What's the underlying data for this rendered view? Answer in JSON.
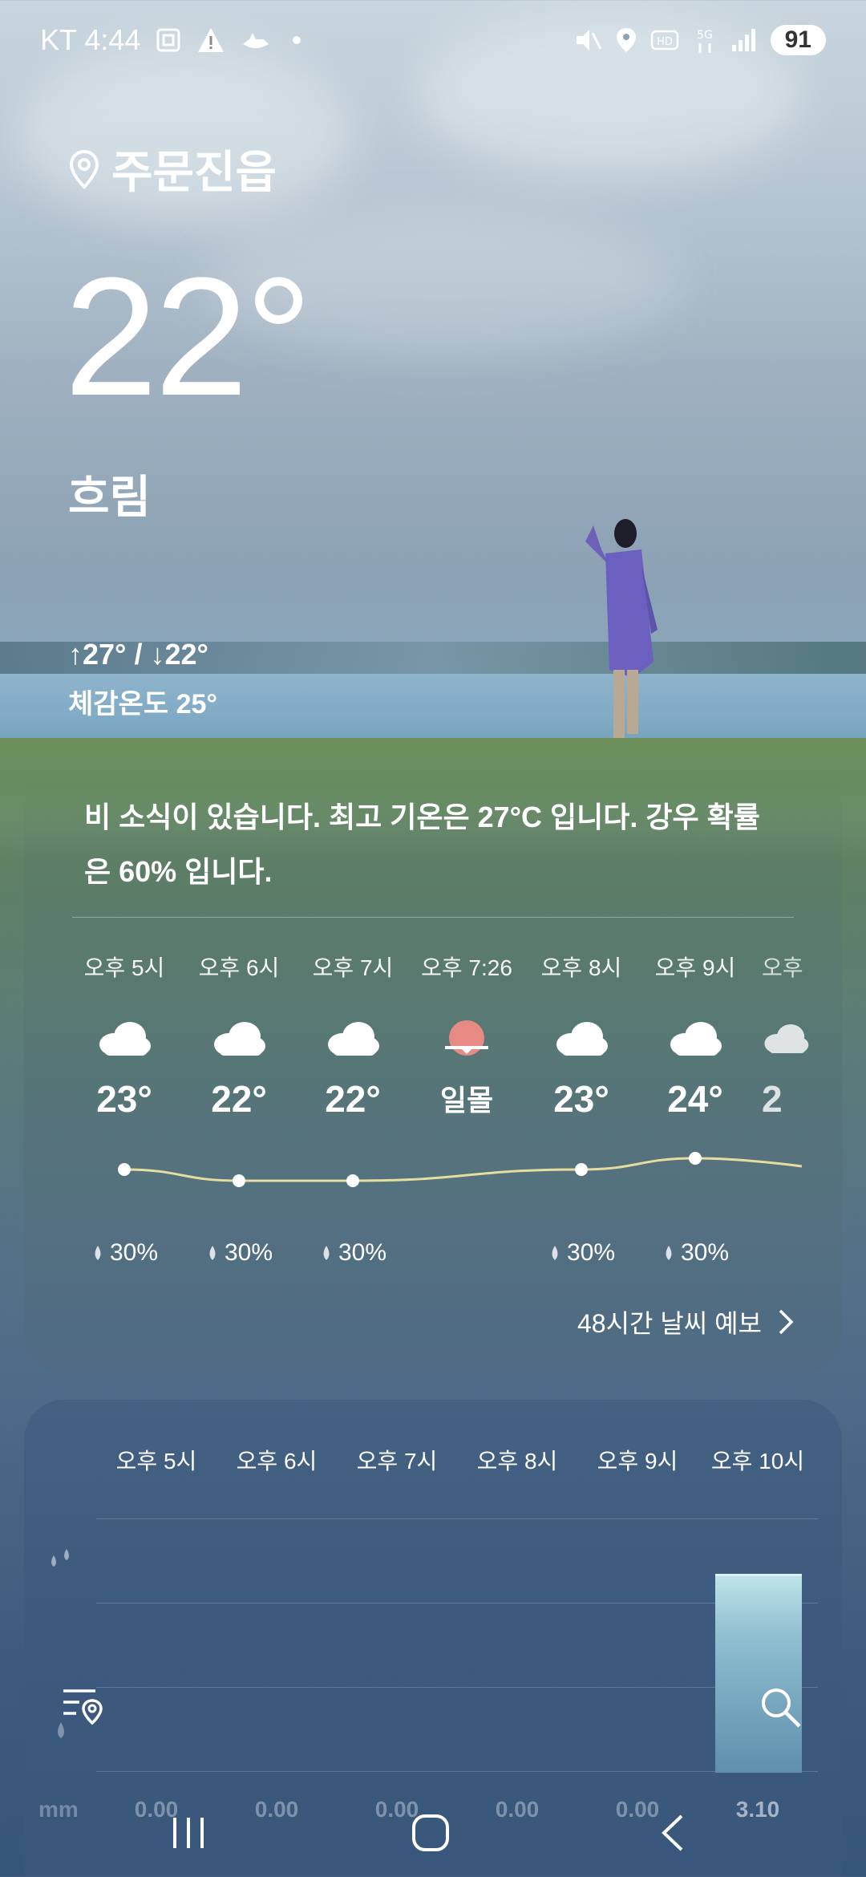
{
  "status": {
    "carrier_time": "KT 4:44",
    "battery": "91",
    "icons": [
      "screenshot-icon",
      "warning-icon",
      "boat-icon",
      "dot-icon",
      "mute-icon",
      "location-icon",
      "hd-icon",
      "5g-icon",
      "signal-icon"
    ]
  },
  "location": {
    "name": "주문진읍",
    "icon": "pin-icon"
  },
  "current": {
    "temp": "22°",
    "condition": "흐림",
    "hilo": "↑27° / ↓22°",
    "feels_like": "체감온도 25°"
  },
  "summary": "비 소식이 있습니다. 최고 기온은 27°C 입니다. 강우 확률은 60% 입니다.",
  "hourly": [
    {
      "time": "오후 5시",
      "icon": "cloud-icon",
      "temp": "23°",
      "precip": "30%",
      "curve_temp": 23
    },
    {
      "time": "오후 6시",
      "icon": "cloud-icon",
      "temp": "22°",
      "precip": "30%",
      "curve_temp": 22
    },
    {
      "time": "오후 7시",
      "icon": "cloud-icon",
      "temp": "22°",
      "precip": "30%",
      "curve_temp": 22
    },
    {
      "time": "오후 7:26",
      "icon": "sunset-icon",
      "temp": "일몰",
      "precip": ""
    },
    {
      "time": "오후 8시",
      "icon": "cloud-icon",
      "temp": "23°",
      "precip": "30%",
      "curve_temp": 23
    },
    {
      "time": "오후 9시",
      "icon": "cloud-icon",
      "temp": "24°",
      "precip": "30%",
      "curve_temp": 24
    },
    {
      "time": "오후",
      "icon": "cloud-icon",
      "temp": "2",
      "precip": ""
    }
  ],
  "more_link": "48시간 날씨 예보",
  "precip_chart": {
    "times": [
      "오후 5시",
      "오후 6시",
      "오후 7시",
      "오후 8시",
      "오후 9시",
      "오후 10시"
    ],
    "amounts": [
      "0.00",
      "0.00",
      "0.00",
      "0.00",
      "0.00",
      "3.10"
    ],
    "unit": "mm"
  },
  "colors": {
    "curve": "#e6dca0",
    "sunset": "#e88a84",
    "rain_bar": "#8fbfd0"
  }
}
